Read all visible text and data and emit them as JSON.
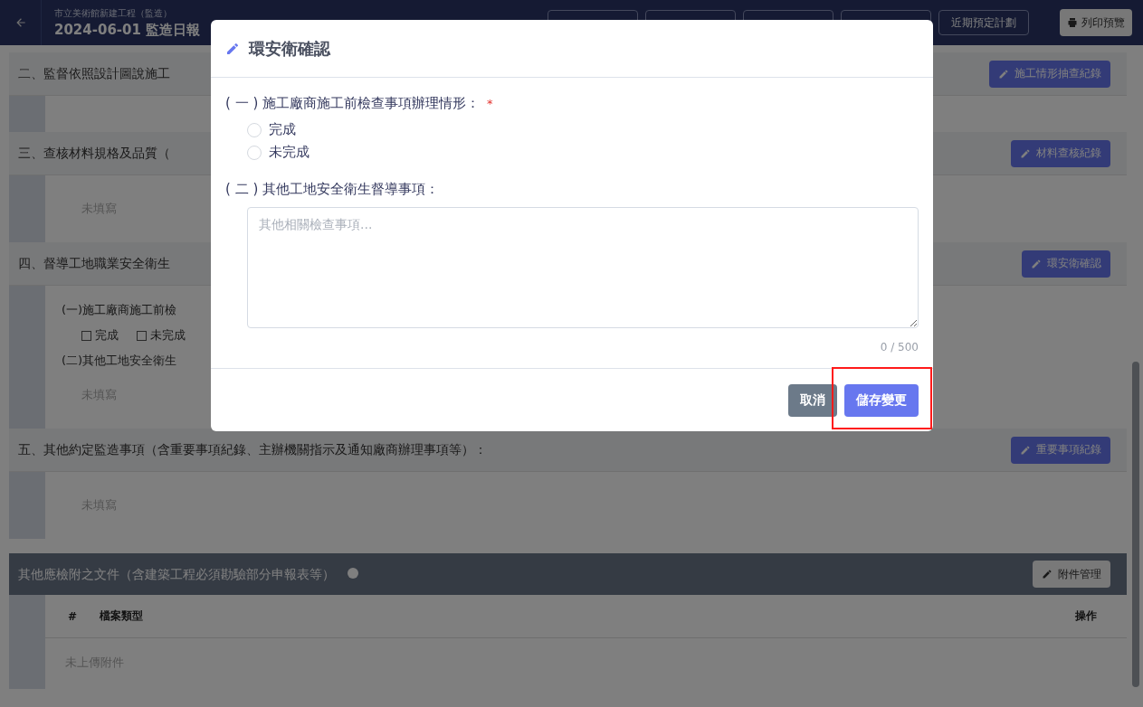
{
  "header": {
    "project": "市立美術館新建工程（監造）",
    "title": "2024-06-01 監造日報",
    "nav_buttons": [
      {
        "kind": "blank"
      },
      {
        "kind": "blank"
      },
      {
        "kind": "blank"
      },
      {
        "kind": "blank"
      },
      {
        "kind": "text",
        "label": "近期預定計劃"
      }
    ],
    "print_button": "列印預覽"
  },
  "sections": [
    {
      "title": "二、監督依照設計圖說施工",
      "action": "施工情形抽查紀錄"
    },
    {
      "title": "三、查核材料規格及品質（",
      "action": "材料查核紀錄",
      "body": [
        {
          "kind": "empty",
          "text": "未填寫"
        }
      ]
    },
    {
      "title": "四、督導工地職業安全衛生",
      "action": "環安衛確認",
      "body": [
        {
          "kind": "label",
          "text": "(一)施工廠商施工前檢"
        },
        {
          "kind": "checks",
          "options": [
            {
              "label": "完成",
              "checked": false
            },
            {
              "label": "未完成",
              "checked": false
            }
          ]
        },
        {
          "kind": "label",
          "text": "(二)其他工地安全衛生"
        },
        {
          "kind": "empty",
          "text": "未填寫"
        }
      ]
    },
    {
      "title": "五、其他約定監造事項（含重要事項紀錄、主辦機關指示及通知廠商辦理事項等）：",
      "action": "重要事項紀錄",
      "body": [
        {
          "kind": "empty",
          "text": "未填寫"
        }
      ]
    }
  ],
  "attachments": {
    "title": "其他應檢附之文件（含建築工程必須勘驗部分申報表等）",
    "action": "附件管理",
    "columns": [
      "#",
      "檔案類型",
      "操作"
    ],
    "empty": "未上傳附件"
  },
  "dialog": {
    "title": "環安衛確認",
    "q1": {
      "label": "( 一 ) 施工廠商施工前檢查事項辦理情形：",
      "required_mark": "*",
      "options": [
        {
          "label": "完成",
          "selected": false
        },
        {
          "label": "未完成",
          "selected": false
        }
      ]
    },
    "q2": {
      "label": "( 二 ) 其他工地安全衛生督導事項：",
      "placeholder": "其他相關檢查事項...",
      "counter": "0 / 500"
    },
    "cancel": "取消",
    "save": "儲存變更",
    "save_highlighted": true
  }
}
